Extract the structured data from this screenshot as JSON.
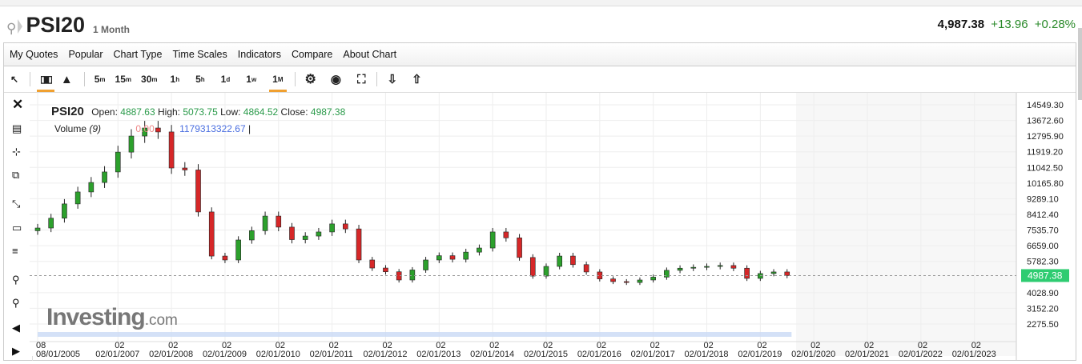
{
  "header": {
    "symbol": "PSI20",
    "period": "1 Month",
    "last": "4,987.38",
    "change": "+13.96",
    "change_pct": "+0.28%"
  },
  "menu": [
    "My Quotes",
    "Popular",
    "Chart Type",
    "Time Scales",
    "Indicators",
    "Compare",
    "About Chart"
  ],
  "toolbar": {
    "intervals": [
      {
        "n": "5",
        "u": "m"
      },
      {
        "n": "15",
        "u": "m"
      },
      {
        "n": "30",
        "u": "m"
      },
      {
        "n": "1",
        "u": "h"
      },
      {
        "n": "5",
        "u": "h"
      },
      {
        "n": "1",
        "u": "d"
      },
      {
        "n": "1",
        "u": "w"
      },
      {
        "n": "1",
        "u": "M"
      }
    ],
    "active_interval": "1M",
    "active_chart_type": "candles"
  },
  "legend": {
    "symbol": "PSI20",
    "open_label": "Open:",
    "open": "4887.63",
    "high_label": "High:",
    "high": "5073.75",
    "low_label": "Low:",
    "low": "4864.52",
    "close_label": "Close:",
    "close": "4987.38",
    "volume_label": "Volume",
    "volume_period": "(9)",
    "volume_ma": "0.00",
    "volume_value": "1179313322.67"
  },
  "logo": {
    "main": "Investing",
    "suffix": ".com"
  },
  "colors": {
    "up": "#2ca02c",
    "down": "#d62728",
    "price_tag": "#2ecc71",
    "accent": "#f0a030"
  },
  "chart_data": {
    "type": "candlestick",
    "y_ticks": [
      "14549.30",
      "13672.60",
      "12795.90",
      "11919.20",
      "11042.50",
      "10165.80",
      "9289.10",
      "8412.40",
      "7535.70",
      "6659.00",
      "5782.30",
      "4028.90",
      "3152.20",
      "2275.50"
    ],
    "ylim": [
      2275.5,
      14549.3
    ],
    "x_ticks": [
      {
        "top": "08",
        "bottom": "08/01/2005"
      },
      {
        "top": "02",
        "bottom": "02/01/2007"
      },
      {
        "top": "02",
        "bottom": "02/01/2008"
      },
      {
        "top": "02",
        "bottom": "02/01/2009"
      },
      {
        "top": "02",
        "bottom": "02/01/2010"
      },
      {
        "top": "02",
        "bottom": "02/01/2011"
      },
      {
        "top": "02",
        "bottom": "02/01/2012"
      },
      {
        "top": "02",
        "bottom": "02/01/2013"
      },
      {
        "top": "02",
        "bottom": "02/01/2014"
      },
      {
        "top": "02",
        "bottom": "02/01/2015"
      },
      {
        "top": "02",
        "bottom": "02/01/2016"
      },
      {
        "top": "02",
        "bottom": "02/01/2017"
      },
      {
        "top": "02",
        "bottom": "02/01/2018"
      },
      {
        "top": "02",
        "bottom": "02/01/2019"
      },
      {
        "top": "02",
        "bottom": "02/01/2020"
      },
      {
        "top": "02",
        "bottom": "02/01/2021"
      },
      {
        "top": "02",
        "bottom": "02/01/2022"
      },
      {
        "top": "02",
        "bottom": "02/01/2023"
      }
    ],
    "start": "2005-08",
    "step_months": 3,
    "closes": [
      7650,
      8200,
      9000,
      9670,
      10200,
      10790,
      11900,
      12800,
      13250,
      13030,
      11010,
      10900,
      8550,
      6080,
      5860,
      6980,
      7500,
      8320,
      7700,
      7000,
      7200,
      7430,
      7880,
      7600,
      5860,
      5410,
      5200,
      4740,
      5300,
      5860,
      6100,
      5900,
      6300,
      6530,
      7430,
      7100,
      6000,
      4960,
      5500,
      6080,
      5600,
      5190,
      4800,
      4650,
      4600,
      4740,
      4900,
      5280,
      5400,
      5450,
      5500,
      5550,
      5400,
      4830,
      5100,
      5190,
      4987.38
    ],
    "last_price_tag": "4987.38",
    "grid": true
  }
}
